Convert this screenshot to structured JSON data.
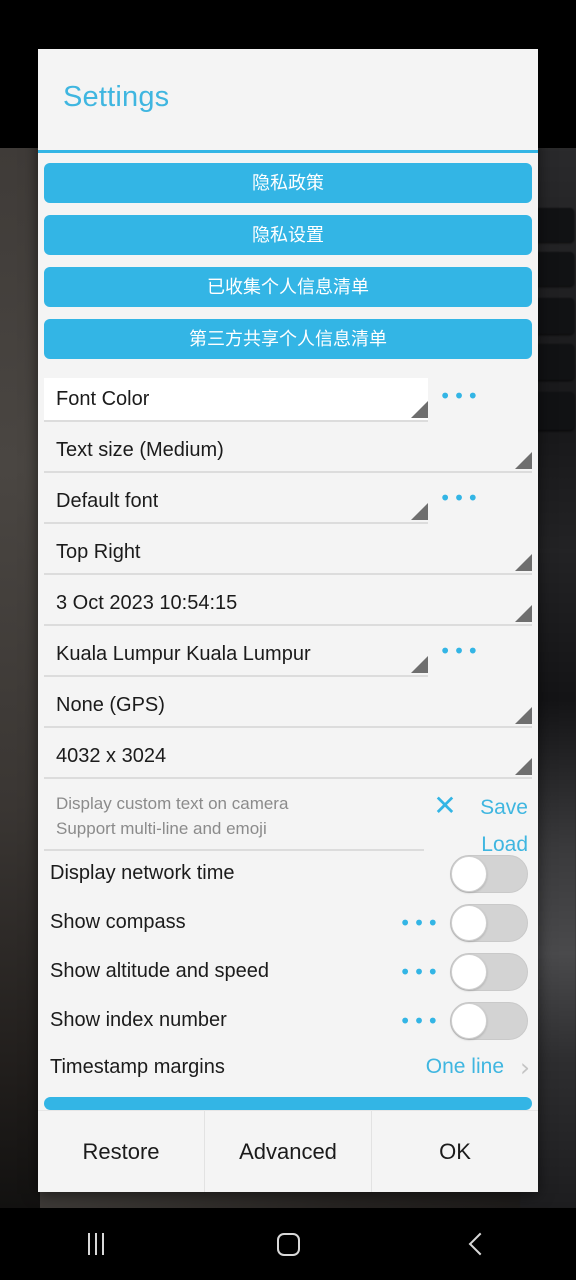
{
  "colors": {
    "accent_blue": "#33b5e5",
    "title_blue": "#3fb6e0",
    "dialog_bg": "#f4f4f4",
    "text_primary": "#1b1b1b",
    "hint_gray": "#8b8b8b",
    "switch_track": "#d3d3d3",
    "navbar_bg": "#000000"
  },
  "dialog": {
    "title": "Settings",
    "privacy_buttons": [
      {
        "label": "隐私政策"
      },
      {
        "label": "隐私设置"
      },
      {
        "label": "已收集个人信息清单"
      },
      {
        "label": "第三方共享个人信息清单"
      }
    ],
    "spinners": [
      {
        "value": "Font Color",
        "has_dots": true,
        "dots": "•••",
        "focused": true,
        "width": "short"
      },
      {
        "value": "Text size (Medium)",
        "has_dots": false,
        "dots": "",
        "focused": false,
        "width": "wide"
      },
      {
        "value": "Default font",
        "has_dots": true,
        "dots": "•••",
        "focused": false,
        "width": "short"
      },
      {
        "value": "Top Right",
        "has_dots": false,
        "dots": "",
        "focused": false,
        "width": "wide"
      },
      {
        "value": "3 Oct 2023 10:54:15",
        "has_dots": false,
        "dots": "",
        "focused": false,
        "width": "wide"
      },
      {
        "value": "Kuala Lumpur Kuala Lumpur",
        "has_dots": true,
        "dots": "•••",
        "focused": false,
        "width": "short"
      },
      {
        "value": "None (GPS)",
        "has_dots": false,
        "dots": "",
        "focused": false,
        "width": "wide"
      },
      {
        "value": "4032 x 3024",
        "has_dots": false,
        "dots": "",
        "focused": false,
        "width": "wide"
      }
    ],
    "custom_text": {
      "value": "",
      "placeholder_line1": "Display custom text on camera",
      "placeholder_line2": "Support multi-line and emoji",
      "clear_icon": "✕",
      "save_label": "Save",
      "load_label": "Load"
    },
    "toggles": [
      {
        "label": "Display network time",
        "has_dots": false,
        "dots": "",
        "on": false
      },
      {
        "label": "Show compass",
        "has_dots": true,
        "dots": "•••",
        "on": false
      },
      {
        "label": "Show altitude and speed",
        "has_dots": true,
        "dots": "•••",
        "on": false
      },
      {
        "label": "Show index number",
        "has_dots": true,
        "dots": "•••",
        "on": false
      }
    ],
    "margins_row": {
      "label": "Timestamp margins",
      "value": "One line",
      "chevron": "›"
    },
    "buttons": [
      {
        "label": "Restore"
      },
      {
        "label": "Advanced"
      },
      {
        "label": "OK"
      }
    ]
  },
  "navbar": {
    "recents_label": "recents",
    "home_label": "home",
    "back_label": "back"
  }
}
